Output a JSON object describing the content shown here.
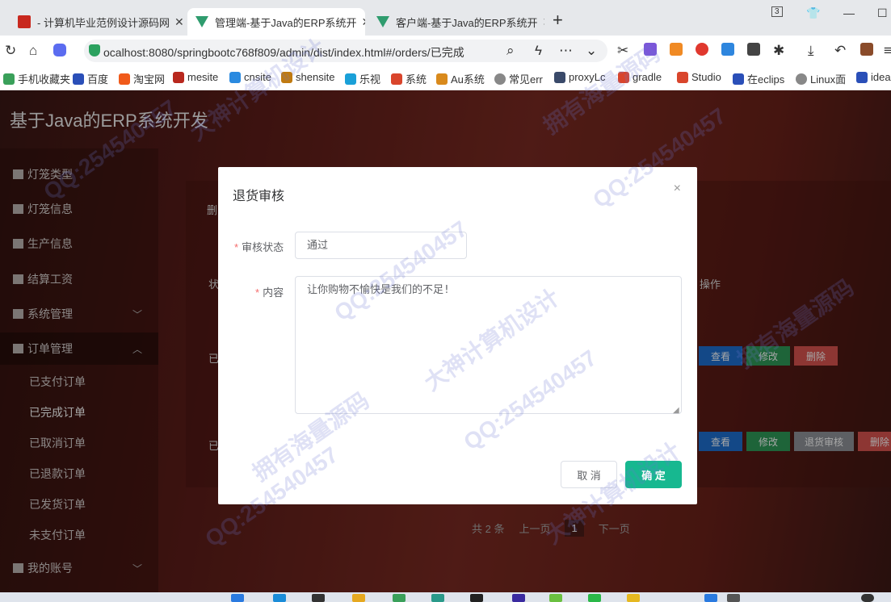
{
  "browser": {
    "tabs": [
      {
        "label": "- 计算机毕业范例设计源码网",
        "close": "✕"
      },
      {
        "label": "管理端-基于Java的ERP系统开",
        "close": "✕"
      },
      {
        "label": "客户端-基于Java的ERP系统开",
        "close": "✕"
      }
    ],
    "new_tab": "+",
    "tab_count": "3",
    "address": "ocalhost:8080/springbootc768f809/admin/dist/index.html#/orders/已完成",
    "bookmarks": [
      "手机收藏夹",
      "百度",
      "淘宝网",
      "mesite",
      "cnsite",
      "shensite",
      "乐视",
      "系统",
      "Au系统",
      "常见err",
      "proxyLc",
      "gradle",
      "Studio",
      "在eclips",
      "Linux面",
      "idea"
    ]
  },
  "app": {
    "title": "基于Java的ERP系统开发",
    "menu": [
      {
        "label": "灯笼类型"
      },
      {
        "label": "灯笼信息"
      },
      {
        "label": "生产信息"
      },
      {
        "label": "结算工资"
      },
      {
        "label": "系统管理",
        "arrow": "﹀"
      },
      {
        "label": "订单管理",
        "arrow": "︿"
      }
    ],
    "order_submenu": [
      "已支付订单",
      "已完成订单",
      "已取消订单",
      "已退款订单",
      "已发货订单",
      "未支付订单"
    ],
    "account_menu": {
      "label": "我的账号",
      "arrow": "﹀"
    },
    "background": {
      "delete_btn": "删",
      "status_header": "状",
      "action_header": "操作",
      "row_status": [
        "已",
        "已"
      ],
      "row_buttons": [
        [
          "查看",
          "修改",
          "删除"
        ],
        [
          "查看",
          "修改",
          "退货审核",
          "删除"
        ]
      ],
      "pager": {
        "total": "共 2 条",
        "prev": "上一页",
        "page": "1",
        "next": "下一页"
      }
    }
  },
  "dialog": {
    "title": "退货审核",
    "close": "×",
    "status_label": "审核状态",
    "status_value": "通过",
    "content_label": "内容",
    "content_value": "让你购物不愉快是我们的不足!",
    "required_mark": "*",
    "cancel_label": "取 消",
    "ok_label": "确 定"
  },
  "watermark": [
    "QQ:254540457",
    "大神计算机设计",
    "拥有海量源码"
  ],
  "colors": {
    "primary": "#17b890",
    "required": "#f56c6c",
    "view_btn": "#1e6fd0",
    "edit_btn": "#2e9a58",
    "delete_btn": "#d9534f",
    "refund_btn": "#909399"
  }
}
